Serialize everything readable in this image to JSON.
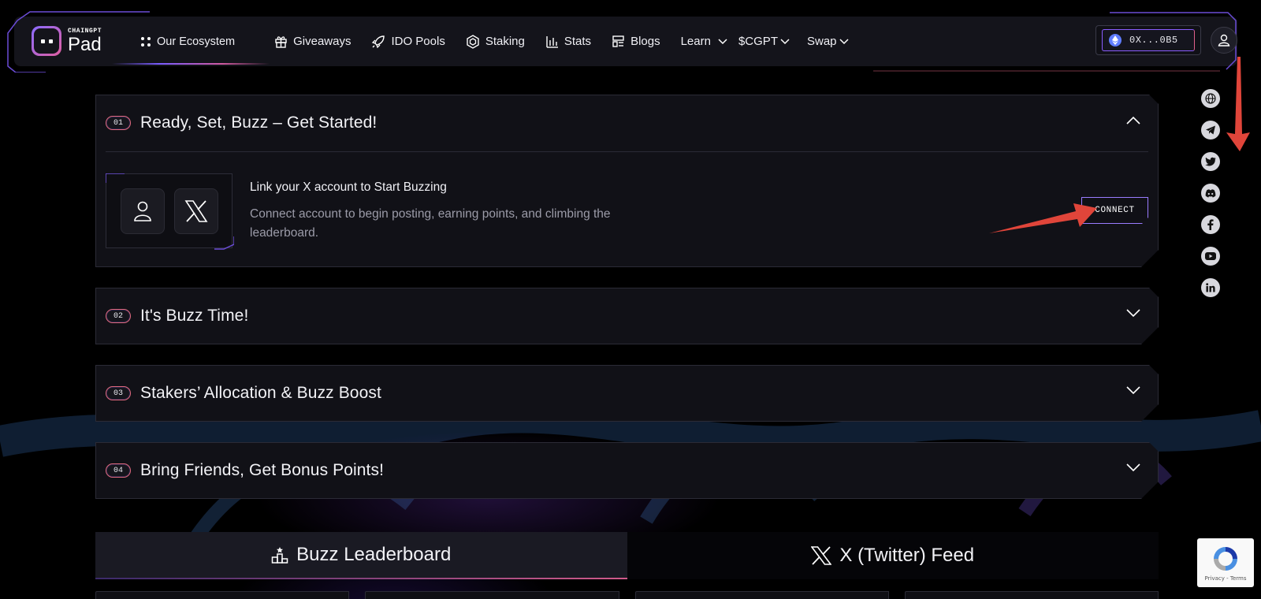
{
  "logo": {
    "small": "CHAINGPT",
    "big": "Pad"
  },
  "nav": {
    "ecosystem": "Our Ecosystem",
    "giveaways": "Giveaways",
    "ido_pools": "IDO Pools",
    "staking": "Staking",
    "stats": "Stats",
    "blogs": "Blogs",
    "learn": "Learn",
    "cgpt": "$CGPT",
    "swap": "Swap"
  },
  "wallet": {
    "address": "0X...0B5"
  },
  "socials": [
    "globe-icon",
    "telegram-icon",
    "twitter-icon",
    "discord-icon",
    "facebook-icon",
    "youtube-icon",
    "linkedin-icon"
  ],
  "steps": [
    {
      "num": "01",
      "title": "Ready, Set, Buzz – Get Started!",
      "expanded": true
    },
    {
      "num": "02",
      "title": "It's Buzz Time!",
      "expanded": false
    },
    {
      "num": "03",
      "title": "Stakers’ Allocation & Buzz Boost",
      "expanded": false
    },
    {
      "num": "04",
      "title": "Bring Friends, Get Bonus Points!",
      "expanded": false
    }
  ],
  "connect": {
    "title": "Link your X account to Start Buzzing",
    "description": "Connect account to begin posting, earning points, and climbing the leaderboard.",
    "button": "CONNECT"
  },
  "tabs": [
    {
      "label": "Buzz Leaderboard",
      "active": true
    },
    {
      "label": "X (Twitter) Feed",
      "active": false
    }
  ],
  "recaptcha": {
    "links": "Privacy - Terms"
  },
  "colors": {
    "accent_purple": "#8a5cff",
    "accent_pink": "#e05f8a",
    "annotation_red": "#e0453a"
  }
}
